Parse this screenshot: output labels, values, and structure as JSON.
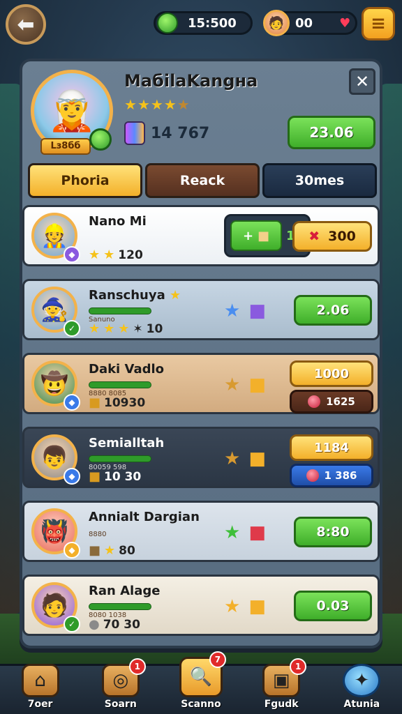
{
  "topbar": {
    "back_icon": "back-arrow-icon",
    "coins": "15:500",
    "lives": "00",
    "lives_icon": "heart-icon",
    "menu_icon": "menu-icon"
  },
  "hero": {
    "name": "MaбilaKangнa",
    "stars_total": 5,
    "level_badge": "Lз8бб",
    "power_value": "14 767",
    "button_value": "23.06",
    "close_icon": "close-icon"
  },
  "tabs": [
    {
      "label": "Phoria",
      "active": true
    },
    {
      "label": "Reack",
      "active": false
    },
    {
      "label": "30mes",
      "active": false
    }
  ],
  "rows": [
    {
      "name": "Nano Mi",
      "stat": "120",
      "button": "300",
      "extra": "1"
    },
    {
      "name": "Ranschuya",
      "sub": "Sanuno",
      "stat": "10",
      "button": "2.06"
    },
    {
      "name": "Daki Vadlo",
      "sub": "8880 8085",
      "stat": "10930",
      "gold": "1000",
      "secondary": "1625"
    },
    {
      "name": "Semialltah",
      "sub": "80059 598",
      "stat": "10 30",
      "gold": "1184",
      "secondary": "1 386"
    },
    {
      "name": "Annialt Dargian",
      "sub": "8880",
      "stat": "80",
      "button": "8:80"
    },
    {
      "name": "Ran Alage",
      "sub": "8080 1038",
      "stat": "70 30",
      "button": "0.03"
    }
  ],
  "bottom_nav": [
    {
      "label": "7oer",
      "icon": "home-icon",
      "badge": ""
    },
    {
      "label": "Soarn",
      "icon": "coin-icon",
      "badge": "1"
    },
    {
      "label": "Scanno",
      "icon": "search-icon",
      "badge": "7"
    },
    {
      "label": "Fgudk",
      "icon": "crate-icon",
      "badge": "1"
    },
    {
      "label": "Atunia",
      "icon": "star-icon",
      "badge": ""
    }
  ]
}
